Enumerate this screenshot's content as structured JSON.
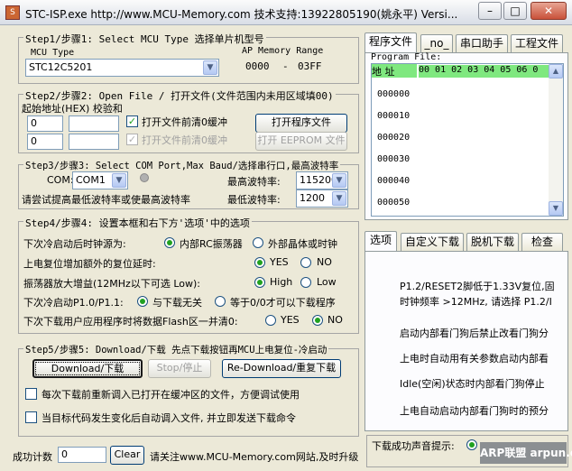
{
  "window": {
    "title": "STC-ISP.exe     http://www.MCU-Memory.com 技术支持:13922805190(姚永平) Versi..."
  },
  "step1": {
    "title": "Step1/步骤1: Select MCU Type  选择单片机型号",
    "mcu_type_label": "MCU Type",
    "mcu_type_value": "STC12C5201",
    "ap_memory_label": "AP Memory Range",
    "range_start": "0000",
    "range_sep": "-",
    "range_end": "03FF"
  },
  "step2": {
    "title": "Step2/步骤2: Open File / 打开文件(文件范围内未用区域填00)",
    "addr_label": "起始地址(HEX) 校验和",
    "addr1": "0",
    "addr2": "0",
    "check1_label": "打开文件前清0缓冲",
    "check2_label": "打开文件前清0缓冲",
    "open_program_btn": "打开程序文件",
    "open_eeprom_btn": "打开 EEPROM 文件"
  },
  "step3": {
    "title": "Step3/步骤3: Select COM Port,Max Baud/选择串行口,最高波特率",
    "com_label": "COM:",
    "com_value": "COM1",
    "max_baud_label": "最高波特率:",
    "max_baud_value": "115200",
    "hint_label": "请尝试提高最低波特率或使最高波特率",
    "min_baud_label": "最低波特率:",
    "min_baud_value": "1200"
  },
  "step4": {
    "title": "Step4/步骤4: 设置本框和右下方'选项'中的选项",
    "row1_label": "下次冷启动后时钟源为:",
    "row1_opt1": "内部RC振荡器",
    "row1_opt2": "外部晶体或时钟",
    "row2_label": "上电复位增加额外的复位延时:",
    "row2_opt1": "YES",
    "row2_opt2": "NO",
    "row3_label": "振荡器放大增益(12MHz以下可选 Low):",
    "row3_opt1": "High",
    "row3_opt2": "Low",
    "row4_label": "下次冷启动P1.0/P1.1:",
    "row4_opt1": "与下载无关",
    "row4_opt2": "等于0/0才可以下载程序",
    "row5_label": "下次下载用户应用程序时将数据Flash区一并清0:",
    "row5_opt1": "YES",
    "row5_opt2": "NO"
  },
  "step5": {
    "title": "Step5/步骤5: Download/下载  先点下载按钮再MCU上电复位-冷启动",
    "download_btn": "Download/下载",
    "stop_btn": "Stop/停止",
    "redownload_btn": "Re-Download/重复下载",
    "check1_label": "每次下载前重新调入已打开在缓冲区的文件，方便调试使用",
    "check2_label": "当目标代码发生变化后自动调入文件, 并立即发送下载命令"
  },
  "footer": {
    "success_label": "成功计数",
    "success_value": "0",
    "clear_btn": "Clear",
    "notice": "请关注www.MCU-Memory.com网站,及时升级"
  },
  "right_tabs": [
    "程序文件",
    "_no_",
    "串口助手",
    "工程文件"
  ],
  "program_file": {
    "label": "Program File:",
    "header_addr": "地 址",
    "header_cols": "00 01 02 03 04 05 06 0",
    "rows": [
      "000000",
      "000010",
      "000020",
      "000030",
      "000040",
      "000050"
    ]
  },
  "option_tabs": [
    "选项",
    "自定义下载",
    "脱机下载",
    "检查"
  ],
  "options_text": [
    "P1.2/RESET2脚低于1.33V复位,固",
    "时钟频率 >12MHz, 请选择 P1.2/I",
    "启动内部看门狗后禁止改看门狗分",
    "上电时自动用有关参数启动内部看",
    "Idle(空闲)状态时内部看门狗停止",
    "上电自动启动内部看门狗时的预分"
  ],
  "bottom_right": {
    "sound_label": "下载成功声音提示:",
    "watermark": "ARP联盟 arpun.com"
  },
  "colors": {
    "highlight_green": "#7fe87f",
    "title_bg": "#dfe3ea",
    "window_bg": "#ece9d8"
  }
}
